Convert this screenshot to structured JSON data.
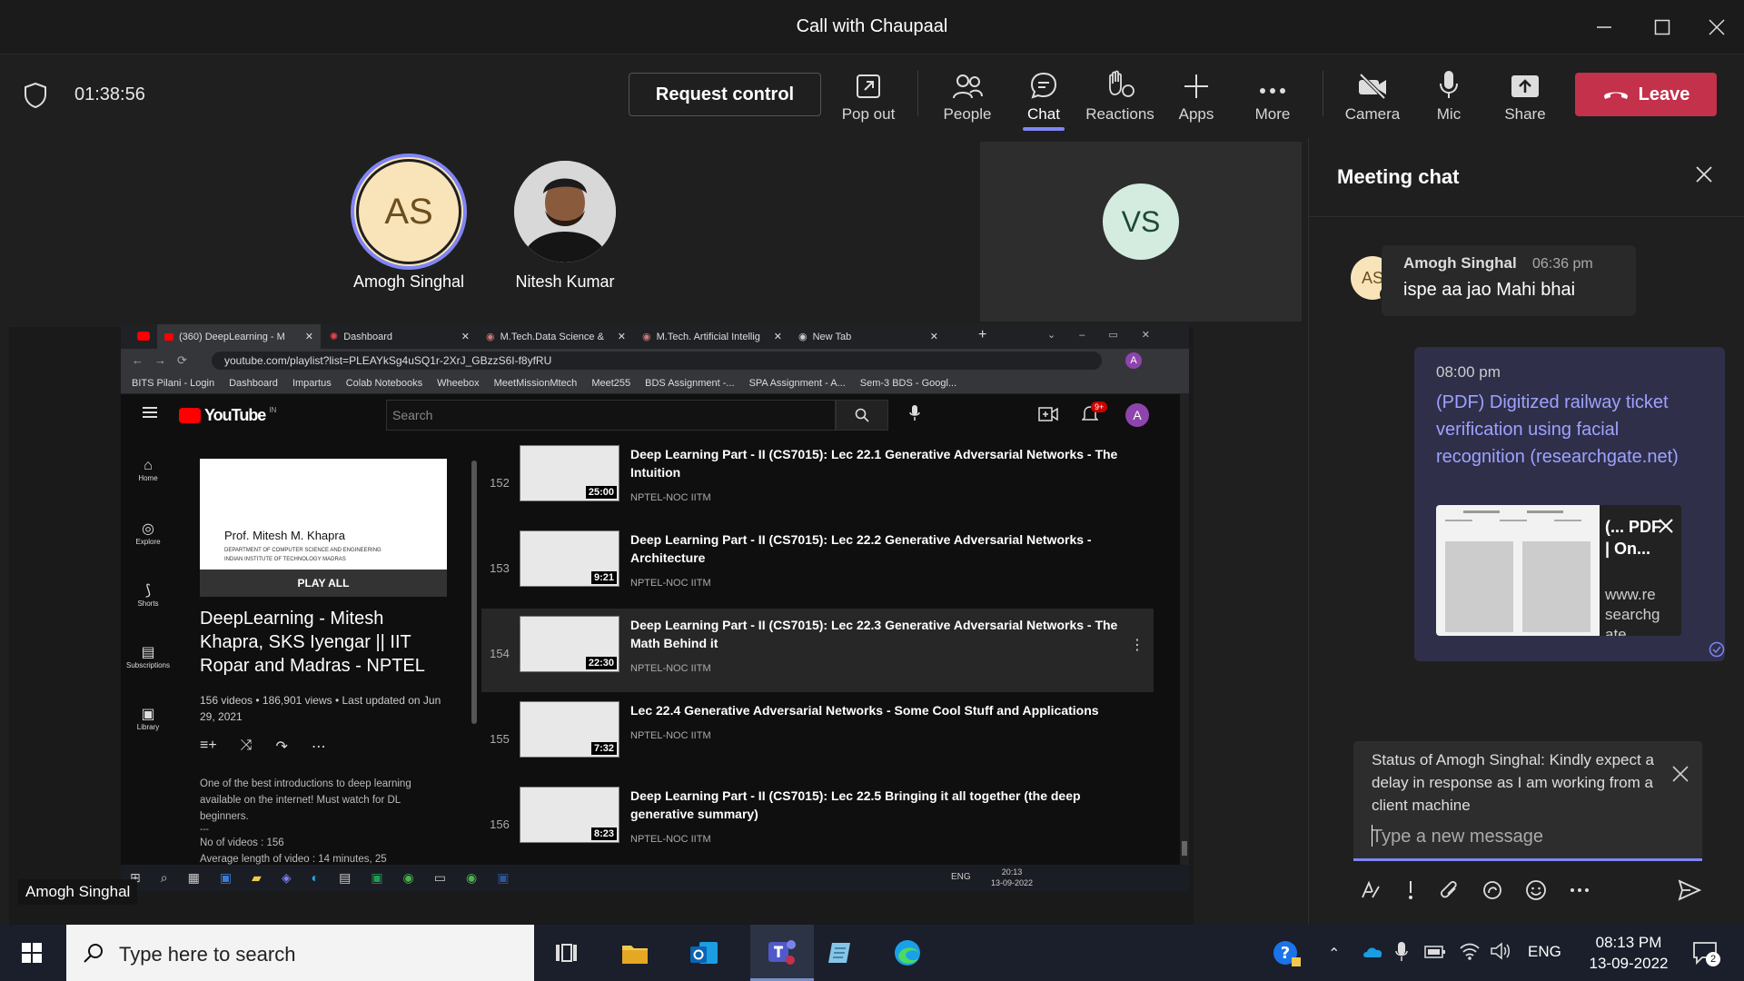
{
  "window": {
    "title": "Call with Chaupaal"
  },
  "toolbar": {
    "timer": "01:38:56",
    "request_control": "Request control",
    "buttons": {
      "popout": "Pop out",
      "people": "People",
      "chat": "Chat",
      "reactions": "Reactions",
      "apps": "Apps",
      "more": "More",
      "camera": "Camera",
      "mic": "Mic",
      "share": "Share"
    },
    "leave": "Leave"
  },
  "participants": [
    {
      "initials": "AS",
      "name": "Amogh Singhal"
    },
    {
      "name": "Nitesh Kumar"
    },
    {
      "initials": "VS"
    }
  ],
  "presenter_label": "Amogh Singhal",
  "browser": {
    "tabs": [
      "(360) DeepLearning - M",
      "Dashboard",
      "M.Tech.Data Science &",
      "M.Tech. Artificial Intellig",
      "New Tab"
    ],
    "url": "youtube.com/playlist?list=PLEAYkSg4uSQ1r-2XrJ_GBzzS6I-f8yfRU",
    "bookmarks": [
      "BITS Pilani - Login",
      "Dashboard",
      "Impartus",
      "Colab Notebooks",
      "Wheebox",
      "MeetMissionMtech",
      "Meet255",
      "BDS Assignment -...",
      "SPA Assignment - A...",
      "Sem-3 BDS - Googl..."
    ],
    "youtube": {
      "logo": "YouTube",
      "region": "IN",
      "search_placeholder": "Search",
      "notif_badge": "9+",
      "avatar": "A",
      "nav": [
        "Home",
        "Explore",
        "Shorts",
        "Subscriptions",
        "Library"
      ],
      "playlist": {
        "thumb_name": "Prof. Mitesh M. Khapra",
        "thumb_dept": "DEPARTMENT OF COMPUTER SCIENCE AND ENGINEERING",
        "thumb_inst": "INDIAN INSTITUTE OF TECHNOLOGY MADRAS",
        "play_all": "PLAY ALL",
        "title": "DeepLearning - Mitesh Khapra, SKS Iyengar || IIT Ropar and Madras - NPTEL",
        "stats": "156 videos • 186,901 views • Last updated on Jun 29, 2021",
        "description": "One of the best introductions to deep learning available on the internet! Must watch for DL beginners.",
        "dash": "---",
        "extra1": "No of videos : 156",
        "extra2": "Average length of video : 14 minutes, 25"
      },
      "videos": [
        {
          "num": "152",
          "title": "Deep Learning Part - II (CS7015): Lec 22.1 Generative Adversarial Networks - The Intuition",
          "channel": "NPTEL-NOC IITM",
          "duration": "25:00"
        },
        {
          "num": "153",
          "title": "Deep Learning Part - II (CS7015): Lec 22.2 Generative Adversarial Networks - Architecture",
          "channel": "NPTEL-NOC IITM",
          "duration": "9:21"
        },
        {
          "num": "154",
          "title": "Deep Learning Part - II (CS7015): Lec 22.3 Generative Adversarial Networks - The Math Behind it",
          "channel": "NPTEL-NOC IITM",
          "duration": "22:30"
        },
        {
          "num": "155",
          "title": "Lec 22.4 Generative Adversarial Networks - Some Cool Stuff and Applications",
          "channel": "NPTEL-NOC IITM",
          "duration": "7:32"
        },
        {
          "num": "156",
          "title": "Deep Learning Part - II (CS7015): Lec 22.5 Bringing it all together (the deep generative summary)",
          "channel": "NPTEL-NOC IITM",
          "duration": "8:23"
        }
      ]
    },
    "taskbar": {
      "lang": "ENG",
      "time": "20:13",
      "date": "13-09-2022"
    }
  },
  "chat": {
    "title": "Meeting chat",
    "message1": {
      "initials": "AS",
      "sender": "Amogh Singhal",
      "time": "06:36 pm",
      "text": "ispe aa jao Mahi bhai"
    },
    "message2": {
      "time": "08:00 pm",
      "link": "(PDF) Digitized railway ticket verification using facial recognition (researchgate.net)",
      "card_title": "(... PDF | On...",
      "card_source": "www.researchgate..."
    },
    "status_notice": "Status of Amogh Singhal: Kindly expect a delay in response as I am working from a client machine",
    "input_placeholder": "Type a new message"
  },
  "taskbar": {
    "search_placeholder": "Type here to search",
    "lang": "ENG",
    "time": "08:13 PM",
    "date": "13-09-2022",
    "notif_count": "2"
  },
  "colors": {
    "accent": "#7f85f5",
    "leave": "#c4314b",
    "link": "#9ea2ff",
    "chat_bubble_self": "#2f2f4a"
  }
}
